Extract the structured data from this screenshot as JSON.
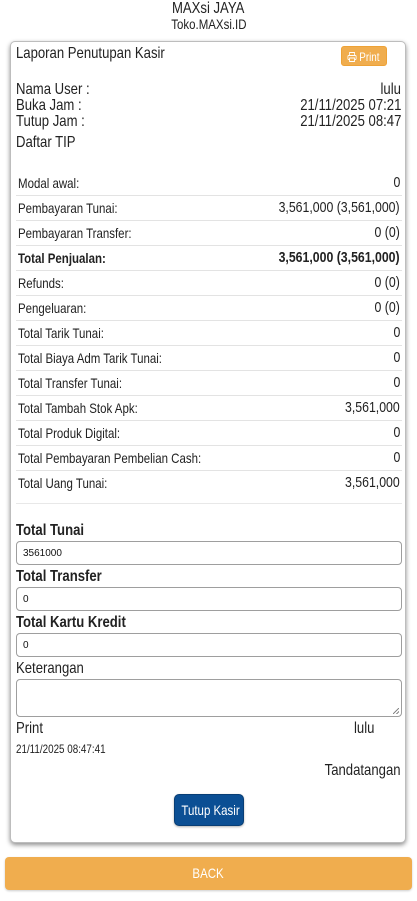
{
  "header": {
    "store_name": "MAXsi JAYA",
    "store_domain": "Toko.MAXsi.ID"
  },
  "report": {
    "title": "Laporan Penutupan Kasir",
    "print_label": "Print",
    "print_icon": "print-icon",
    "info": {
      "nama_user_label": "Nama User :",
      "nama_user_value": "lulu",
      "buka_jam_label": "Buka Jam :",
      "buka_jam_value": "21/11/2025 07:21",
      "tutup_jam_label": "Tutup Jam :",
      "tutup_jam_value": "21/11/2025 08:47"
    },
    "tip_label": "Daftar TIP",
    "summary": [
      {
        "label": "Modal awal:",
        "value": "0",
        "bold": false
      },
      {
        "label": "Pembayaran Tunai:",
        "value": "3,561,000 (3,561,000)",
        "bold": false
      },
      {
        "label": "Pembayaran Transfer:",
        "value": "0 (0)",
        "bold": false
      },
      {
        "label": "Total Penjualan:",
        "value": "3,561,000 (3,561,000)",
        "bold": true
      },
      {
        "label": "Refunds:",
        "value": "0 (0)",
        "bold": false
      },
      {
        "label": "Pengeluaran:",
        "value": "0 (0)",
        "bold": false
      },
      {
        "label": "Total Tarik Tunai:",
        "value": "0",
        "bold": false
      },
      {
        "label": "Total Biaya Adm Tarik Tunai:",
        "value": "0",
        "bold": false
      },
      {
        "label": "Total Transfer Tunai:",
        "value": "0",
        "bold": false
      },
      {
        "label": "Total Tambah Stok Apk:",
        "value": "3,561,000",
        "bold": false
      },
      {
        "label": "Total Produk Digital:",
        "value": "0",
        "bold": false
      },
      {
        "label": "Total Pembayaran Pembelian Cash:",
        "value": "0",
        "bold": false
      },
      {
        "label": "Total Uang Tunai:",
        "value": "3,561,000",
        "bold": false
      }
    ],
    "form": {
      "total_tunai_label": "Total Tunai",
      "total_tunai_value": "3561000",
      "total_transfer_label": "Total Transfer",
      "total_transfer_value": "0",
      "total_kartu_kredit_label": "Total Kartu Kredit",
      "total_kartu_kredit_value": "0",
      "keterangan_label": "Keterangan",
      "keterangan_value": ""
    },
    "signature": {
      "print_label": "Print",
      "user": "lulu",
      "printed_at": "21/11/2025 08:47:41",
      "sign_label": "Tandatangan"
    },
    "tutup_kasir_label": "Tutup Kasir"
  },
  "back_label": "BACK",
  "colors": {
    "print_button": "#f0ad4e",
    "tutup_button": "#0b4f94",
    "back_button": "#f0ad4e"
  }
}
